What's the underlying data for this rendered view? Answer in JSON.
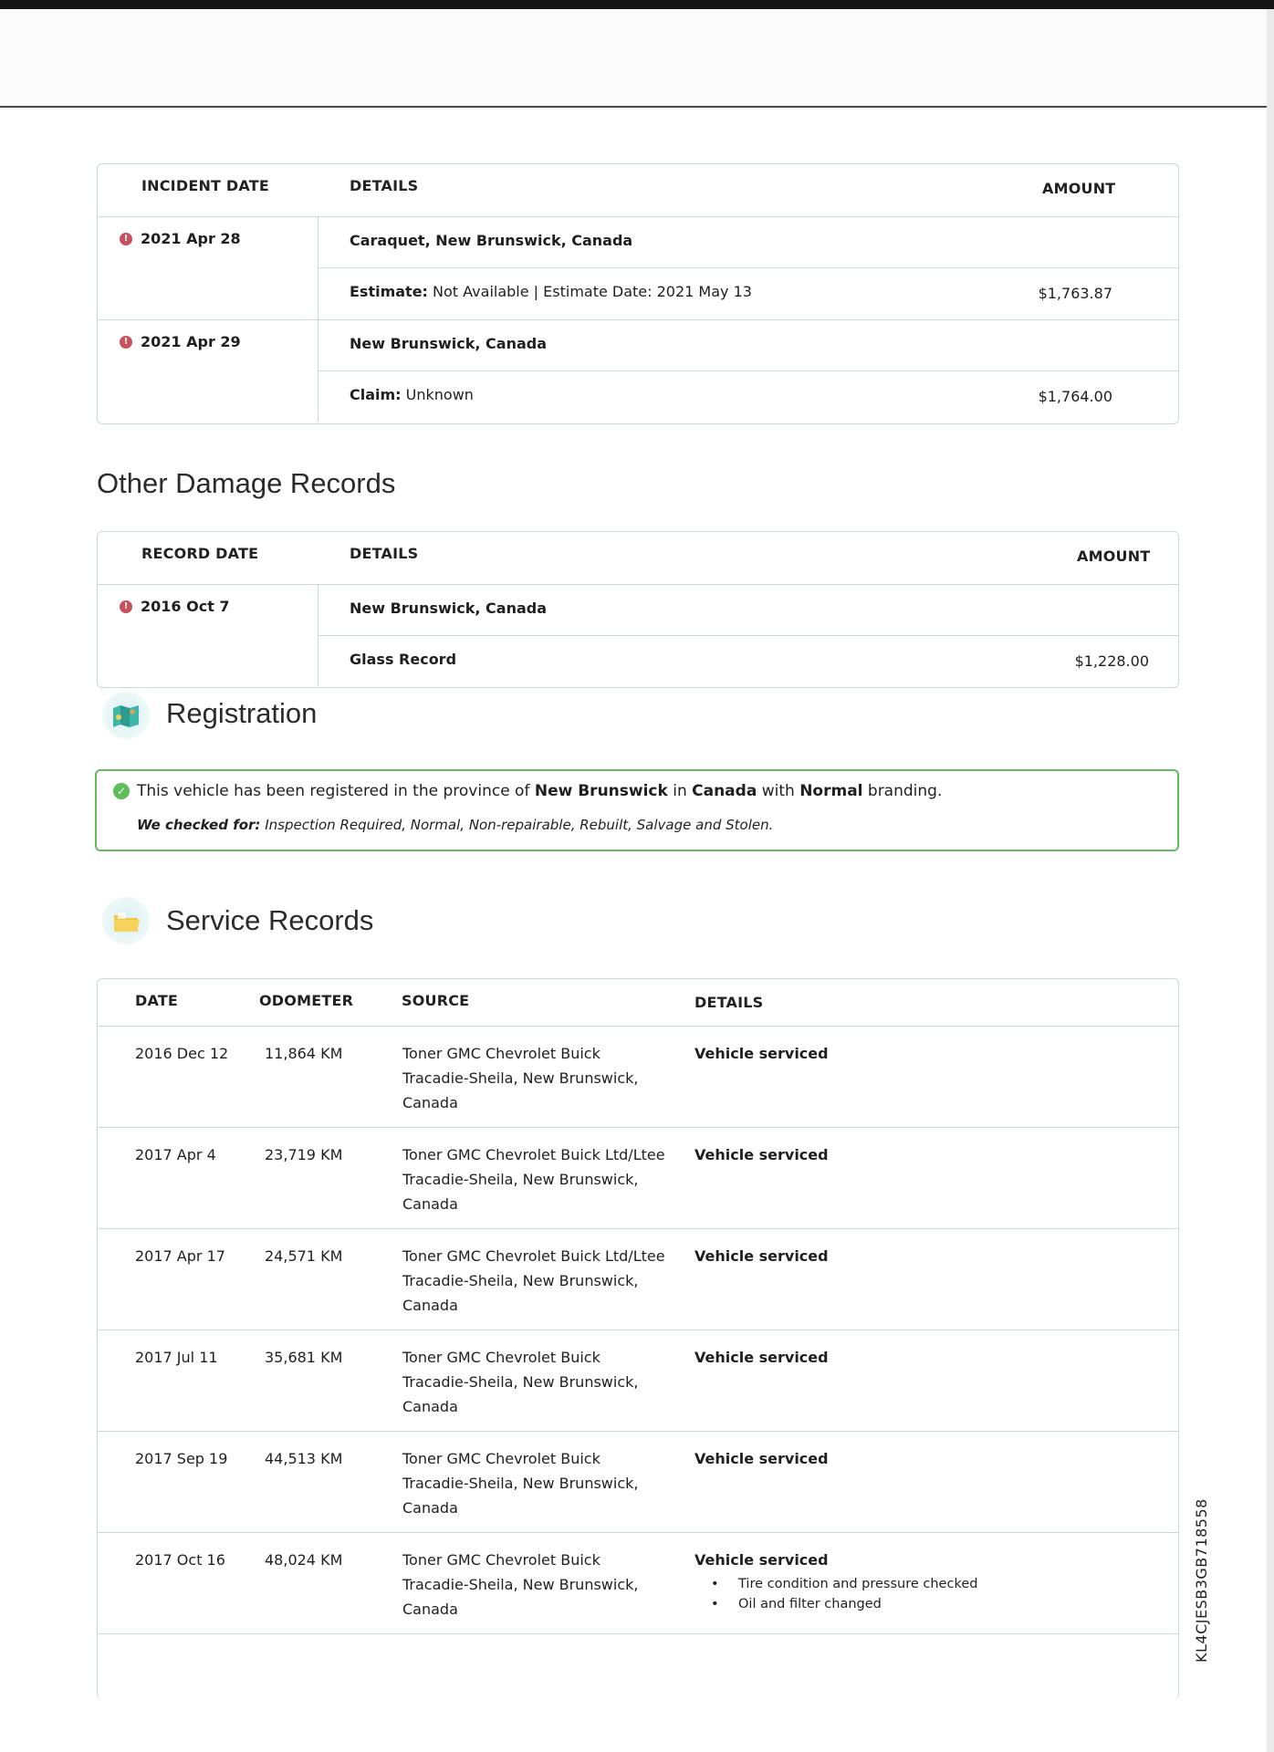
{
  "incidents": {
    "headers": [
      "INCIDENT DATE",
      "DETAILS",
      "AMOUNT"
    ],
    "rows": [
      {
        "date": "2021 Apr 28",
        "location": "Caraquet, New Brunswick, Canada",
        "detail_label": "Estimate:",
        "detail_value": "Not Available | Estimate Date: 2021 May 13",
        "amount": "$1,763.87"
      },
      {
        "date": "2021 Apr 29",
        "location": "New Brunswick, Canada",
        "detail_label": "Claim:",
        "detail_value": "Unknown",
        "amount": "$1,764.00"
      }
    ]
  },
  "other_damage": {
    "title": "Other Damage Records",
    "headers": [
      "RECORD DATE",
      "DETAILS",
      "AMOUNT"
    ],
    "rows": [
      {
        "date": "2016 Oct 7",
        "location": "New Brunswick, Canada",
        "detail_label": "Glass Record",
        "amount": "$1,228.00"
      }
    ]
  },
  "registration": {
    "title": "Registration",
    "text_1": "This vehicle has been registered in the province of",
    "province": "New Brunswick",
    "text_2": "in",
    "country": "Canada",
    "text_3": "with",
    "branding": "Normal",
    "text_4": "branding.",
    "checked_label": "We checked for:",
    "checked_list": "Inspection Required, Normal, Non-repairable, Rebuilt, Salvage and Stolen."
  },
  "service": {
    "title": "Service Records",
    "headers": [
      "DATE",
      "ODOMETER",
      "SOURCE",
      "DETAILS"
    ],
    "rows": [
      {
        "date": "2016 Dec 12",
        "odometer": "11,864 KM",
        "source_1": "Toner GMC Chevrolet Buick",
        "source_2": "Tracadie-Sheila, New Brunswick,",
        "source_3": "Canada",
        "detail": "Vehicle serviced",
        "bullets": []
      },
      {
        "date": "2017 Apr 4",
        "odometer": "23,719 KM",
        "source_1": "Toner GMC Chevrolet Buick Ltd/Ltee",
        "source_2": "Tracadie-Sheila, New Brunswick,",
        "source_3": "Canada",
        "detail": "Vehicle serviced",
        "bullets": []
      },
      {
        "date": "2017 Apr 17",
        "odometer": "24,571 KM",
        "source_1": "Toner GMC Chevrolet Buick Ltd/Ltee",
        "source_2": "Tracadie-Sheila, New Brunswick,",
        "source_3": "Canada",
        "detail": "Vehicle serviced",
        "bullets": []
      },
      {
        "date": "2017 Jul 11",
        "odometer": "35,681 KM",
        "source_1": "Toner GMC Chevrolet Buick",
        "source_2": "Tracadie-Sheila, New Brunswick,",
        "source_3": "Canada",
        "detail": "Vehicle serviced",
        "bullets": []
      },
      {
        "date": "2017 Sep 19",
        "odometer": "44,513 KM",
        "source_1": "Toner GMC Chevrolet Buick",
        "source_2": "Tracadie-Sheila, New Brunswick,",
        "source_3": "Canada",
        "detail": "Vehicle serviced",
        "bullets": []
      },
      {
        "date": "2017 Oct 16",
        "odometer": "48,024 KM",
        "source_1": "Toner GMC Chevrolet Buick",
        "source_2": "Tracadie-Sheila, New Brunswick,",
        "source_3": "Canada",
        "detail": "Vehicle serviced",
        "bullets": [
          "Tire condition and pressure checked",
          "Oil and filter changed"
        ]
      }
    ]
  },
  "vin": "KL4CJESB3GB718558",
  "colors": {
    "alert": "#c9505c",
    "success": "#5cbf5a",
    "border": "#c9d8d8"
  },
  "icons": {
    "registration": "map-icon",
    "service": "folder-icon",
    "alert": "alert-circle-icon",
    "check": "check-circle-icon"
  }
}
